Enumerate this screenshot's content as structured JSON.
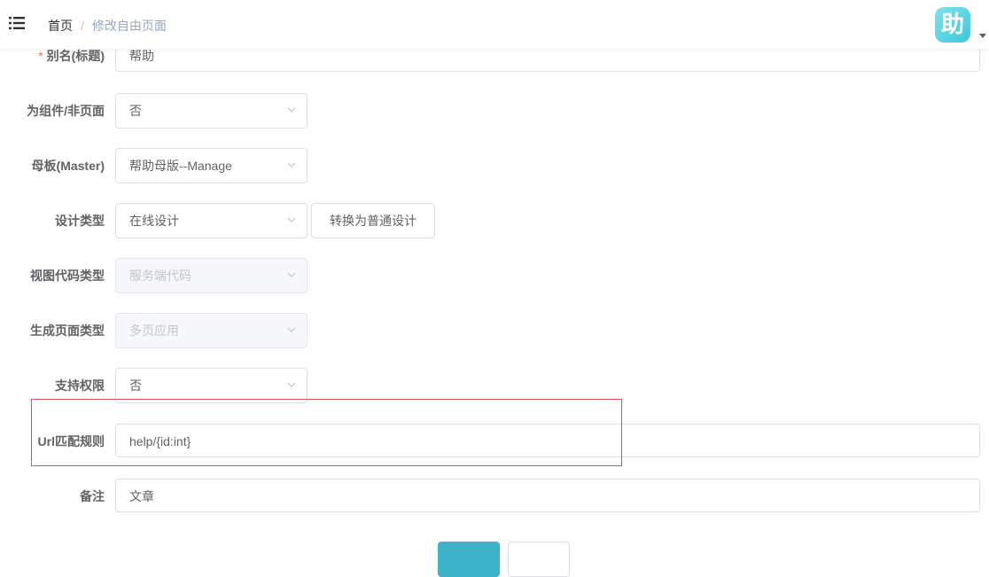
{
  "header": {
    "breadcrumb": {
      "home": "首页",
      "separator": "/",
      "current": "修改自由页面"
    },
    "avatar_text": "助"
  },
  "form": {
    "alias": {
      "label": "别名(标题)",
      "required_mark": "*",
      "value": "帮助"
    },
    "is_component": {
      "label": "为组件/非页面",
      "value": "否"
    },
    "master": {
      "label": "母板(Master)",
      "value": "帮助母版--Manage"
    },
    "design_type": {
      "label": "设计类型",
      "value": "在线设计",
      "convert_button": "转换为普通设计"
    },
    "view_code_type": {
      "label": "视图代码类型",
      "value": "服务端代码"
    },
    "generate_page_type": {
      "label": "生成页面类型",
      "value": "多页应用"
    },
    "support_permission": {
      "label": "支持权限",
      "value": "否"
    },
    "url_rule": {
      "label": "Url匹配规则",
      "value": "help/{id:int}"
    },
    "remark": {
      "label": "备注",
      "value": "文章"
    }
  },
  "colors": {
    "primary": "#3cb3c9",
    "highlight_border": "#d9534f",
    "required": "#f56c6c"
  }
}
